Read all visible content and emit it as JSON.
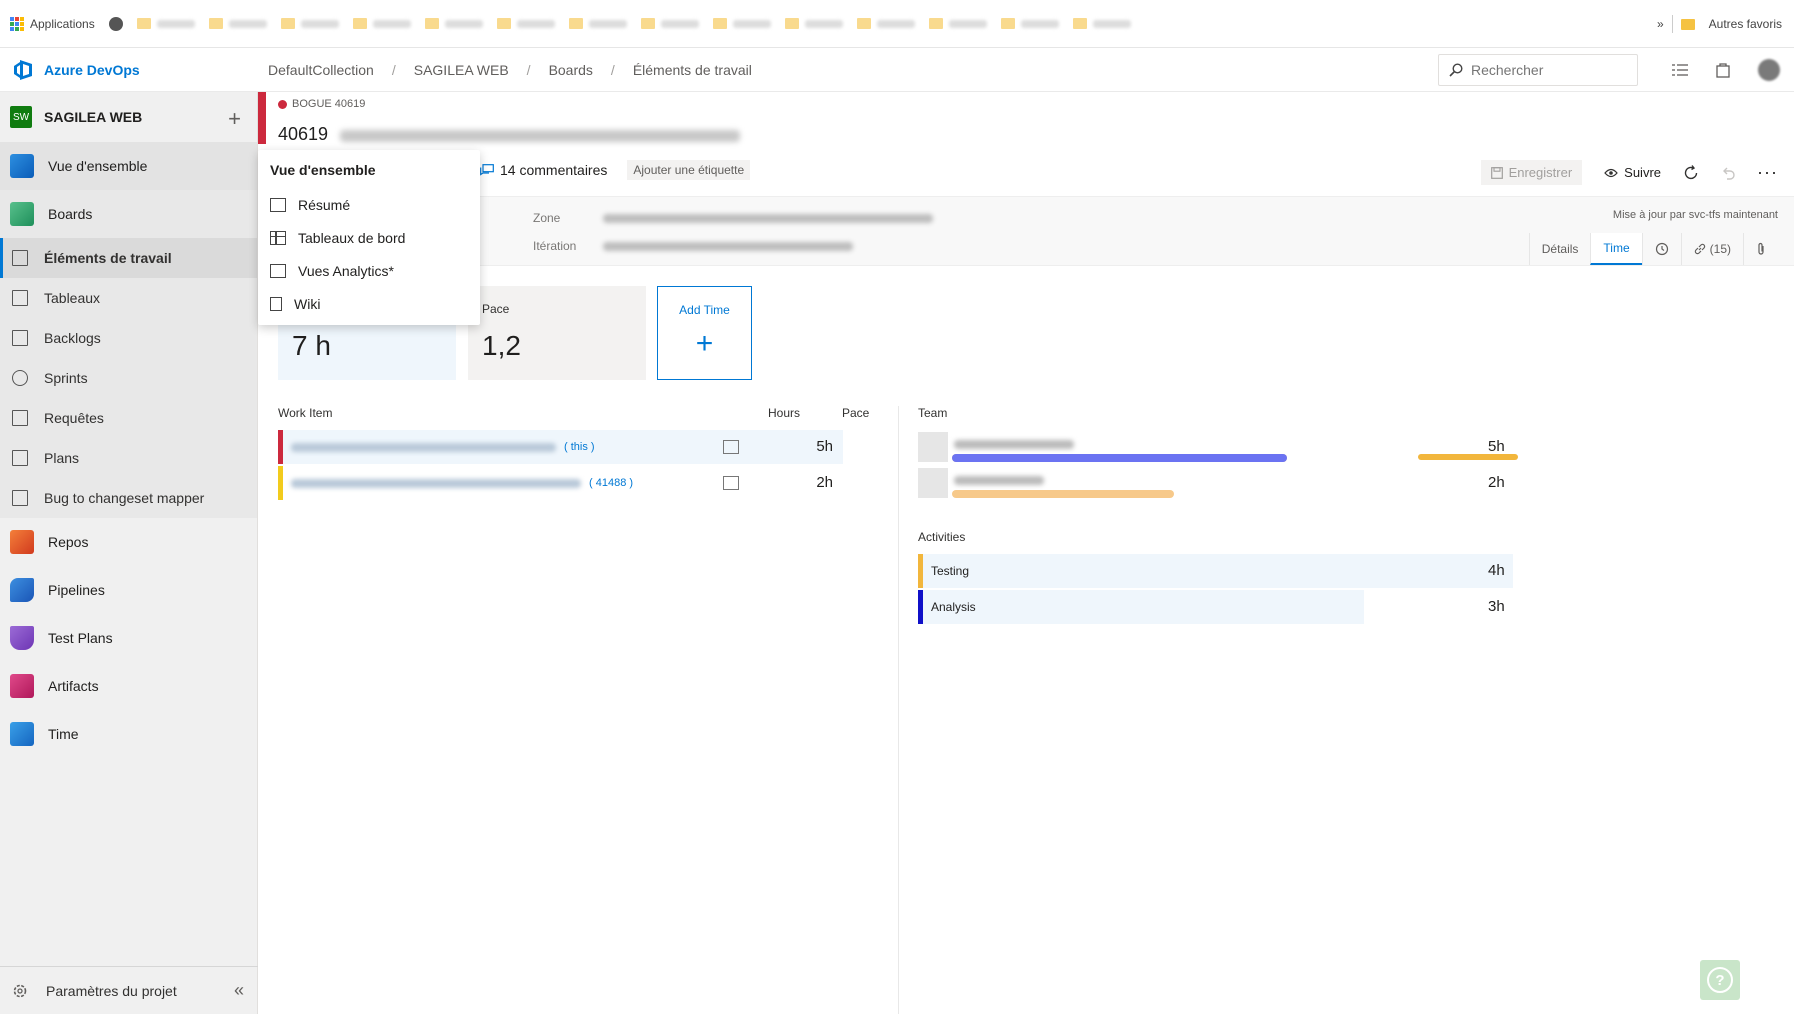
{
  "bookmarks": {
    "apps_label": "Applications",
    "other_favorites": "Autres favoris"
  },
  "header": {
    "brand": "Azure DevOps",
    "breadcrumbs": [
      "DefaultCollection",
      "SAGILEA WEB",
      "Boards",
      "Éléments de travail"
    ],
    "search_placeholder": "Rechercher"
  },
  "sidebar": {
    "project_badge": "SW",
    "project_name": "SAGILEA WEB",
    "overview": "Vue d'ensemble",
    "boards": "Boards",
    "boards_sub": [
      "Éléments de travail",
      "Tableaux",
      "Backlogs",
      "Sprints",
      "Requêtes",
      "Plans",
      "Bug to changeset mapper"
    ],
    "services": [
      "Repos",
      "Pipelines",
      "Test Plans",
      "Artifacts",
      "Time"
    ],
    "settings": "Paramètres du projet"
  },
  "flyout": {
    "heading": "Vue d'ensemble",
    "items": [
      "Résumé",
      "Tableaux de bord",
      "Vues Analytics*",
      "Wiki"
    ]
  },
  "work_item": {
    "type": "BOGUE 40619",
    "id": "40619",
    "comments": "14 commentaires",
    "add_tag": "Ajouter une étiquette",
    "save": "Enregistrer",
    "follow": "Suivre",
    "zone_label": "Zone",
    "iteration_label": "Itération",
    "updated_by": "Mise à jour par svc-tfs maintenant",
    "tabs": [
      "Détails",
      "Time"
    ],
    "links_count": "(15)"
  },
  "time": {
    "cards": [
      {
        "label": "",
        "value": "7 h"
      },
      {
        "label": "Pace",
        "value": "1,2"
      }
    ],
    "add_time": "Add Time",
    "table_headers": {
      "work_item": "Work Item",
      "hours": "Hours",
      "pace": "Pace"
    },
    "rows": [
      {
        "link": "( this )",
        "hours": "5h",
        "color": "#cc293d"
      },
      {
        "link": "( 41488 )",
        "hours": "2h",
        "color": "#f2cb1d"
      }
    ],
    "team_label": "Team",
    "team": [
      {
        "hours": "5h"
      },
      {
        "hours": "2h"
      }
    ],
    "activities_label": "Activities",
    "activities": [
      {
        "name": "Testing",
        "hours": "4h",
        "color": "#f2b63c",
        "fraction": 1.0
      },
      {
        "name": "Analysis",
        "hours": "3h",
        "color": "#1010c8",
        "fraction": 0.75
      }
    ]
  }
}
